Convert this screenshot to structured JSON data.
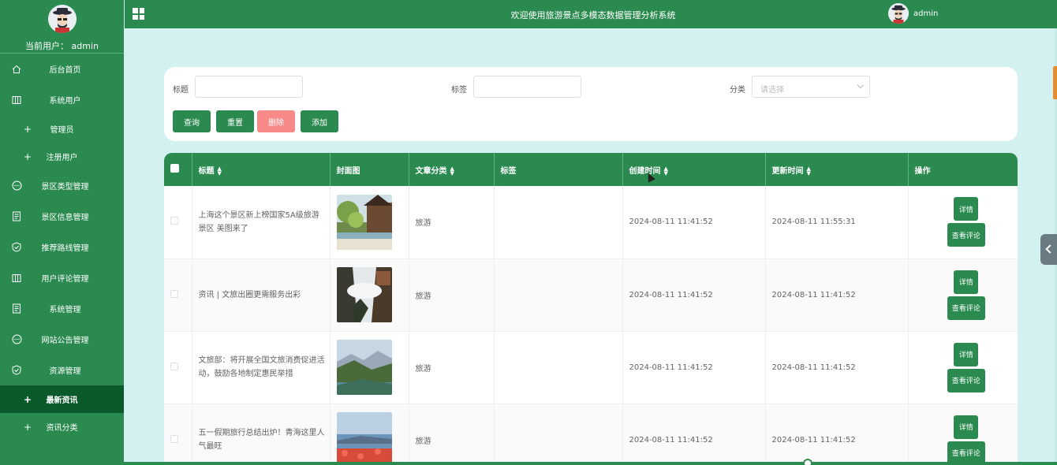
{
  "sidebar": {
    "current_user_label": "当前用户：  admin",
    "items": [
      {
        "label": "后台首页",
        "icon": "home-icon"
      },
      {
        "label": "系统用户",
        "icon": "columns-icon"
      },
      {
        "label": "管理员",
        "icon": "plus-icon"
      },
      {
        "label": "注册用户",
        "icon": "plus-icon"
      },
      {
        "label": "景区类型管理",
        "icon": "chat-icon"
      },
      {
        "label": "景区信息管理",
        "icon": "document-icon"
      },
      {
        "label": "推荐路线管理",
        "icon": "shield-icon"
      },
      {
        "label": "用户评论管理",
        "icon": "columns-icon"
      },
      {
        "label": "系统管理",
        "icon": "document-icon"
      },
      {
        "label": "网站公告管理",
        "icon": "chat-icon"
      },
      {
        "label": "资源管理",
        "icon": "shield-icon"
      },
      {
        "label": "最新资讯",
        "icon": "plus-icon"
      },
      {
        "label": "资讯分类",
        "icon": "plus-icon"
      }
    ]
  },
  "header": {
    "title": "欢迎使用旅游景点多模态数据管理分析系统",
    "username": "admin"
  },
  "search": {
    "title_label": "标题",
    "tag_label": "标签",
    "category_label": "分类",
    "category_placeholder": "请选择",
    "query_button": "查询",
    "reset_button": "重置",
    "delete_button": "删除",
    "add_button": "添加"
  },
  "table": {
    "columns": [
      "标题",
      "封面图",
      "文章分类",
      "标签",
      "创建时间",
      "更新时间",
      "操作"
    ],
    "detail_button": "详情",
    "review_button": "查看评论",
    "rows": [
      {
        "title": "上海这个景区新上榜国家5A级旅游景区 美图来了",
        "category": "旅游",
        "tag": "",
        "created": "2024-08-11 11:41:52",
        "updated": "2024-08-11 11:55:31"
      },
      {
        "title": "资讯 | 文旅出圈更需服务出彩",
        "category": "旅游",
        "tag": "",
        "created": "2024-08-11 11:41:52",
        "updated": "2024-08-11 11:41:52"
      },
      {
        "title": "文旅部：将开展全国文旅消费促进活动，鼓励各地制定惠民举措",
        "category": "旅游",
        "tag": "",
        "created": "2024-08-11 11:41:52",
        "updated": "2024-08-11 11:41:52"
      },
      {
        "title": "五一假期旅行总结出炉！青海这里人气最旺",
        "category": "旅游",
        "tag": "",
        "created": "2024-08-11 11:41:52",
        "updated": "2024-08-11 11:41:52"
      }
    ]
  },
  "colors": {
    "primary": "#2a8a50",
    "active": "#0b5a2c",
    "danger": "#f78989",
    "background": "#d2f1f0"
  }
}
